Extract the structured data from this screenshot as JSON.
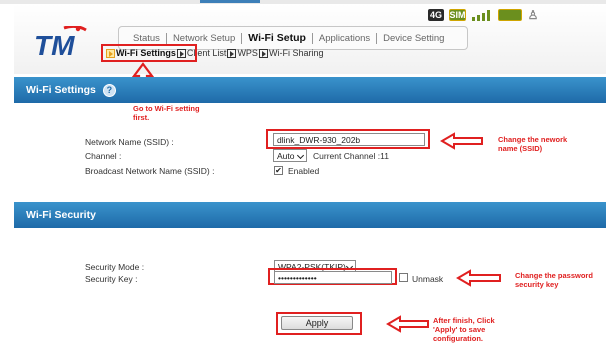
{
  "logo": {
    "text": "TM",
    "dot_color": "#e02020"
  },
  "status_icons": [
    {
      "name": "4g-icon",
      "text": "4G"
    },
    {
      "name": "sim-icon",
      "text": "SIM"
    },
    {
      "name": "signal-icon",
      "text": ""
    },
    {
      "name": "battery-icon",
      "text": ""
    },
    {
      "name": "user-icon",
      "text": "♙"
    }
  ],
  "nav": {
    "tabs": [
      "Status",
      "Network Setup",
      "Wi-Fi Setup",
      "Applications",
      "Device Setting"
    ],
    "active": "Wi-Fi Setup"
  },
  "subnav": {
    "items": [
      "Wi-Fi Settings",
      "Client List",
      "WPS",
      "Wi-Fi Sharing"
    ],
    "active": "Wi-Fi Settings"
  },
  "wifi_settings": {
    "title": "Wi-Fi Settings",
    "help": "?",
    "network_name_label": "Network Name (SSID) :",
    "network_name_value": "dlink_DWR-930_202b",
    "channel_label": "Channel :",
    "channel_value": "Auto",
    "current_channel": "Current Channel :11",
    "broadcast_label": "Broadcast Network Name (SSID) :",
    "broadcast_value": "Enabled"
  },
  "wifi_security": {
    "title": "Wi-Fi Security",
    "mode_label": "Security Mode :",
    "mode_value": "WPA2-PSK(TKIP)",
    "key_label": "Security Key :",
    "key_value": "•••••••••••••",
    "unmask_label": "Unmask"
  },
  "apply_label": "Apply",
  "annotations": {
    "go_to": "Go to Wi-Fi setting\nfirst.",
    "change_name": "Change the nework\nname (SSID)",
    "change_password": "Change the password\nsecurity key",
    "after_finish": "After finish, Click\n'Apply' to save\nconfiguration.",
    "color": "#e02020"
  }
}
